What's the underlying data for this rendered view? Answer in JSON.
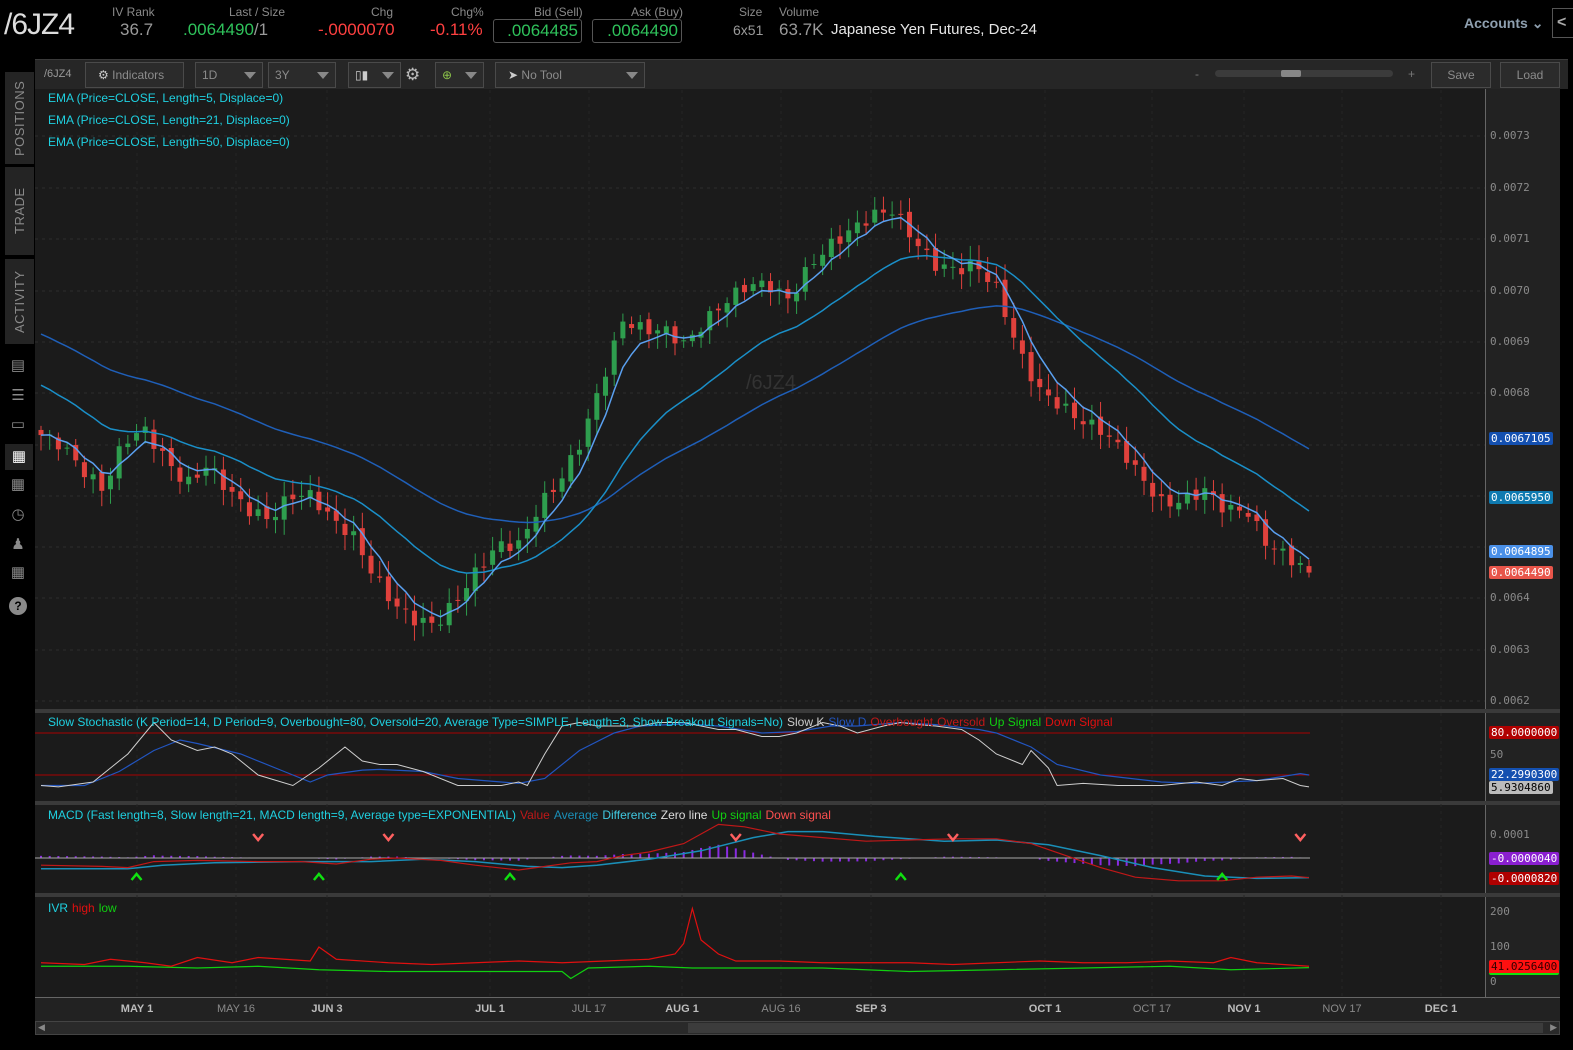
{
  "header": {
    "symbol": "/6JZ4",
    "iv_rank_label": "IV Rank",
    "iv_rank": "36.7",
    "last_size_label": "Last / Size",
    "last": ".0064490",
    "last_size": "/1",
    "chg_label": "Chg",
    "chg": "-.0000070",
    "chgpct_label": "Chg%",
    "chgpct": "-0.11%",
    "bid_label": "Bid (Sell)",
    "bid": ".0064485",
    "ask_label": "Ask (Buy)",
    "ask": ".0064490",
    "size_label": "Size",
    "size": "6x51",
    "volume_label": "Volume",
    "volume": "63.7K",
    "description": "Japanese Yen Futures, Dec-24",
    "accounts": "Accounts"
  },
  "sidebar": {
    "tabs": [
      "POSITIONS",
      "TRADE",
      "ACTIVITY"
    ]
  },
  "toolbar": {
    "symbol": "/6JZ4",
    "indicators": "Indicators",
    "aggregation": "1D",
    "timeframe": "3Y",
    "drawing_tool": "No Tool",
    "zoom_minus": "-",
    "zoom_plus": "+",
    "save": "Save",
    "load": "Load",
    "zoom_level": 0.42
  },
  "studies": {
    "ema": [
      "EMA (Price=CLOSE, Length=5, Displace=0)",
      "EMA (Price=CLOSE, Length=21, Displace=0)",
      "EMA (Price=CLOSE, Length=50, Displace=0)"
    ],
    "stoch": {
      "title": "Slow Stochastic (K Period=14, D Period=9, Overbought=80, Oversold=20, Average Type=SIMPLE, Length=3, Show Breakout Signals=No)",
      "legend": [
        "Slow K",
        "Slow D",
        "Overbought",
        "Oversold",
        "Up Signal",
        "Down Signal"
      ]
    },
    "macd": {
      "title": "MACD (Fast length=8, Slow length=21, MACD length=9, Average type=EXPONENTIAL)",
      "legend": [
        "Value",
        "Average",
        "Difference",
        "Zero line",
        "Up signal",
        "Down signal"
      ]
    },
    "ivr": {
      "title": "IVR",
      "legend": [
        "high",
        "low"
      ]
    }
  },
  "watermark": "/6JZ4",
  "colors": {
    "up": "#2e9e4e",
    "down": "#e0413c",
    "ema5": "#5aa0f0",
    "ema21": "#1a8fc8",
    "ema50": "#1f5fb8",
    "stochK": "#cfcfcf",
    "stochD": "#2255c0",
    "macdValue": "#c01818",
    "macdAvg": "#1a8fb8",
    "macdDiff": "#8a2be2",
    "ivrHigh": "#e01010",
    "ivrLow": "#10d010"
  },
  "chart_data": {
    "type": "candlestick",
    "price_axis": {
      "ticks": [
        "0.0073",
        "0.0072",
        "0.0071",
        "0.0070",
        "0.0069",
        "0.0068",
        "0.0064",
        "0.0063",
        "0.0062"
      ],
      "ylim": [
        0.0062,
        0.0073
      ]
    },
    "date_ticks": [
      {
        "label": "MAY 1",
        "bold": true
      },
      {
        "label": "MAY 16",
        "bold": false
      },
      {
        "label": "JUN 3",
        "bold": true
      },
      {
        "label": "JUL 1",
        "bold": true
      },
      {
        "label": "JUL 17",
        "bold": false
      },
      {
        "label": "AUG 1",
        "bold": true
      },
      {
        "label": "AUG 16",
        "bold": false
      },
      {
        "label": "SEP 3",
        "bold": true
      },
      {
        "label": "OCT 1",
        "bold": true
      },
      {
        "label": "OCT 17",
        "bold": false
      },
      {
        "label": "NOV 1",
        "bold": true
      },
      {
        "label": "NOV 17",
        "bold": false
      },
      {
        "label": "DEC 1",
        "bold": true
      }
    ],
    "bars": 147,
    "close_samples": [
      0.006717,
      0.006698,
      0.006649,
      0.00661,
      0.006707,
      0.006727,
      0.006669,
      0.00662,
      0.006659,
      0.00661,
      0.006571,
      0.006552,
      0.0066,
      0.0066,
      0.006552,
      0.006522,
      0.006444,
      0.006386,
      0.006357,
      0.006347,
      0.006396,
      0.006454,
      0.006503,
      0.006503,
      0.006581,
      0.00663,
      0.006707,
      0.006824,
      0.006941,
      0.006922,
      0.006922,
      0.006893,
      0.006941,
      0.00698,
      0.00701,
      0.00701,
      0.00698,
      0.007049,
      0.007088,
      0.007117,
      0.007146,
      0.007156,
      0.007097,
      0.007049,
      0.007039,
      0.007049,
      0.007,
      0.006883,
      0.006805,
      0.006776,
      0.006746,
      0.006727,
      0.006688,
      0.00663,
      0.006581,
      0.006591,
      0.00661,
      0.006571,
      0.006571,
      0.006503,
      0.00648,
      0.006449
    ],
    "ema_seeds": {
      "ema21": 0.006824,
      "ema50": 0.006922
    },
    "last_values": {
      "ema50": "0.0067105",
      "ema21": "0.0065950",
      "ema5": "0.0064895",
      "last": "0.0064490"
    },
    "stoch": {
      "ylim": [
        0,
        100
      ],
      "overbought": 80,
      "oversold": 20,
      "ticks": [
        "80.0000000",
        "50"
      ],
      "last_d": "22.2990300",
      "last_k": "5.9304860",
      "k": [
        [
          0,
          5
        ],
        [
          2,
          3
        ],
        [
          6,
          10
        ],
        [
          8,
          30
        ],
        [
          10,
          50
        ],
        [
          13,
          95
        ],
        [
          15,
          70
        ],
        [
          18,
          55
        ],
        [
          20,
          60
        ],
        [
          22,
          50
        ],
        [
          25,
          20
        ],
        [
          29,
          5
        ],
        [
          32,
          30
        ],
        [
          35,
          60
        ],
        [
          37,
          40
        ],
        [
          39,
          35
        ],
        [
          41,
          35
        ],
        [
          44,
          25
        ],
        [
          48,
          5
        ],
        [
          53,
          5
        ],
        [
          55,
          10
        ],
        [
          56,
          5
        ],
        [
          58,
          50
        ],
        [
          60,
          90
        ],
        [
          62,
          95
        ],
        [
          64,
          90
        ],
        [
          67,
          90
        ],
        [
          69,
          90
        ],
        [
          71,
          95
        ],
        [
          74,
          95
        ],
        [
          76,
          90
        ],
        [
          78,
          85
        ],
        [
          80,
          85
        ],
        [
          83,
          75
        ],
        [
          85,
          75
        ],
        [
          87,
          80
        ],
        [
          90,
          95
        ],
        [
          92,
          90
        ],
        [
          94,
          80
        ],
        [
          97,
          90
        ],
        [
          99,
          95
        ],
        [
          101,
          92
        ],
        [
          103,
          90
        ],
        [
          106,
          85
        ],
        [
          108,
          70
        ],
        [
          110,
          50
        ],
        [
          113,
          35
        ],
        [
          114,
          55
        ],
        [
          116,
          30
        ],
        [
          117,
          5
        ],
        [
          120,
          8
        ],
        [
          124,
          5
        ],
        [
          129,
          5
        ],
        [
          133,
          10
        ],
        [
          136,
          5
        ],
        [
          138,
          15
        ],
        [
          140,
          12
        ],
        [
          143,
          15
        ],
        [
          145,
          5
        ],
        [
          146,
          3
        ]
      ],
      "d": [
        [
          0,
          5
        ],
        [
          5,
          5
        ],
        [
          9,
          25
        ],
        [
          13,
          55
        ],
        [
          16,
          70
        ],
        [
          18,
          65
        ],
        [
          23,
          50
        ],
        [
          28,
          25
        ],
        [
          31,
          10
        ],
        [
          33,
          20
        ],
        [
          37,
          27
        ],
        [
          39,
          28
        ],
        [
          44,
          25
        ],
        [
          48,
          15
        ],
        [
          55,
          8
        ],
        [
          58,
          15
        ],
        [
          62,
          55
        ],
        [
          66,
          80
        ],
        [
          69,
          90
        ],
        [
          74,
          93
        ],
        [
          78,
          90
        ],
        [
          83,
          80
        ],
        [
          87,
          82
        ],
        [
          91,
          90
        ],
        [
          94,
          90
        ],
        [
          99,
          95
        ],
        [
          103,
          92
        ],
        [
          108,
          85
        ],
        [
          110,
          80
        ],
        [
          114,
          60
        ],
        [
          117,
          35
        ],
        [
          122,
          20
        ],
        [
          129,
          10
        ],
        [
          133,
          8
        ],
        [
          140,
          12
        ],
        [
          145,
          22
        ],
        [
          146,
          20
        ]
      ]
    },
    "macd": {
      "ticks": [
        "0.0001"
      ],
      "last_diff": "-0.0000040",
      "last_value": "-0.0000820",
      "value": [
        [
          0,
          -3e-05
        ],
        [
          7,
          -3.5e-05
        ],
        [
          10,
          -4e-05
        ],
        [
          13,
          -1.5e-05
        ],
        [
          18,
          -1e-05
        ],
        [
          25,
          -1.5e-05
        ],
        [
          30,
          -1.5e-05
        ],
        [
          34,
          -2.5e-05
        ],
        [
          38,
          -5e-06
        ],
        [
          41,
          0
        ],
        [
          46,
          -1e-05
        ],
        [
          50,
          -3e-05
        ],
        [
          55,
          -5e-05
        ],
        [
          57,
          -4e-05
        ],
        [
          61,
          -2e-05
        ],
        [
          64,
          -1.5e-05
        ],
        [
          67,
          1e-05
        ],
        [
          70,
          2.5e-05
        ],
        [
          74,
          6e-05
        ],
        [
          78,
          0.00014
        ],
        [
          81,
          0.00013
        ],
        [
          85,
          0.0001
        ],
        [
          90,
          8.5e-05
        ],
        [
          95,
          7e-05
        ],
        [
          100,
          7.5e-05
        ],
        [
          105,
          8e-05
        ],
        [
          110,
          8e-05
        ],
        [
          114,
          6e-05
        ],
        [
          118,
          1e-05
        ],
        [
          122,
          -4e-05
        ],
        [
          126,
          -8e-05
        ],
        [
          131,
          -9.5e-05
        ],
        [
          136,
          -9.5e-05
        ],
        [
          140,
          -8e-05
        ],
        [
          144,
          -7.5e-05
        ],
        [
          146,
          -8.2e-05
        ]
      ],
      "average": [
        [
          0,
          -4.5e-05
        ],
        [
          10,
          -4.5e-05
        ],
        [
          14,
          -3e-05
        ],
        [
          20,
          -2e-05
        ],
        [
          30,
          -1.5e-05
        ],
        [
          38,
          -1.5e-05
        ],
        [
          44,
          -5e-06
        ],
        [
          50,
          -1.5e-05
        ],
        [
          56,
          -3.5e-05
        ],
        [
          60,
          -4e-05
        ],
        [
          64,
          -3e-05
        ],
        [
          70,
          -5e-06
        ],
        [
          76,
          3e-05
        ],
        [
          82,
          8.5e-05
        ],
        [
          86,
          0.00011
        ],
        [
          90,
          0.00011
        ],
        [
          96,
          9e-05
        ],
        [
          104,
          7e-05
        ],
        [
          110,
          7.5e-05
        ],
        [
          116,
          5.5e-05
        ],
        [
          122,
          1e-05
        ],
        [
          128,
          -4e-05
        ],
        [
          134,
          -7.5e-05
        ],
        [
          140,
          -8.5e-05
        ],
        [
          146,
          -8.2e-05
        ]
      ],
      "up_signals": [
        11,
        32,
        54,
        99,
        136
      ],
      "down_signals": [
        25,
        40,
        80,
        105,
        145
      ]
    },
    "ivr": {
      "ticks": [
        "200",
        "100",
        "0"
      ],
      "last": "41.0256400",
      "high": [
        [
          0,
          55
        ],
        [
          5,
          50
        ],
        [
          8,
          65
        ],
        [
          10,
          60
        ],
        [
          12,
          55
        ],
        [
          15,
          45
        ],
        [
          18,
          70
        ],
        [
          22,
          55
        ],
        [
          25,
          70
        ],
        [
          28,
          65
        ],
        [
          31,
          60
        ],
        [
          32,
          100
        ],
        [
          34,
          65
        ],
        [
          40,
          55
        ],
        [
          45,
          50
        ],
        [
          50,
          55
        ],
        [
          55,
          60
        ],
        [
          60,
          55
        ],
        [
          65,
          60
        ],
        [
          70,
          65
        ],
        [
          73,
          80
        ],
        [
          74,
          110
        ],
        [
          75,
          210
        ],
        [
          76,
          120
        ],
        [
          78,
          80
        ],
        [
          80,
          60
        ],
        [
          85,
          60
        ],
        [
          90,
          55
        ],
        [
          95,
          55
        ],
        [
          100,
          55
        ],
        [
          105,
          50
        ],
        [
          110,
          55
        ],
        [
          115,
          60
        ],
        [
          120,
          55
        ],
        [
          125,
          55
        ],
        [
          130,
          60
        ],
        [
          135,
          55
        ],
        [
          137,
          70
        ],
        [
          140,
          55
        ],
        [
          143,
          50
        ],
        [
          146,
          45
        ]
      ],
      "low": [
        [
          0,
          45
        ],
        [
          10,
          45
        ],
        [
          18,
          40
        ],
        [
          25,
          45
        ],
        [
          32,
          35
        ],
        [
          40,
          30
        ],
        [
          50,
          30
        ],
        [
          60,
          30
        ],
        [
          61,
          10
        ],
        [
          63,
          40
        ],
        [
          70,
          45
        ],
        [
          75,
          40
        ],
        [
          80,
          40
        ],
        [
          90,
          40
        ],
        [
          100,
          30
        ],
        [
          110,
          35
        ],
        [
          120,
          40
        ],
        [
          130,
          45
        ],
        [
          137,
          35
        ],
        [
          146,
          41
        ]
      ]
    }
  }
}
